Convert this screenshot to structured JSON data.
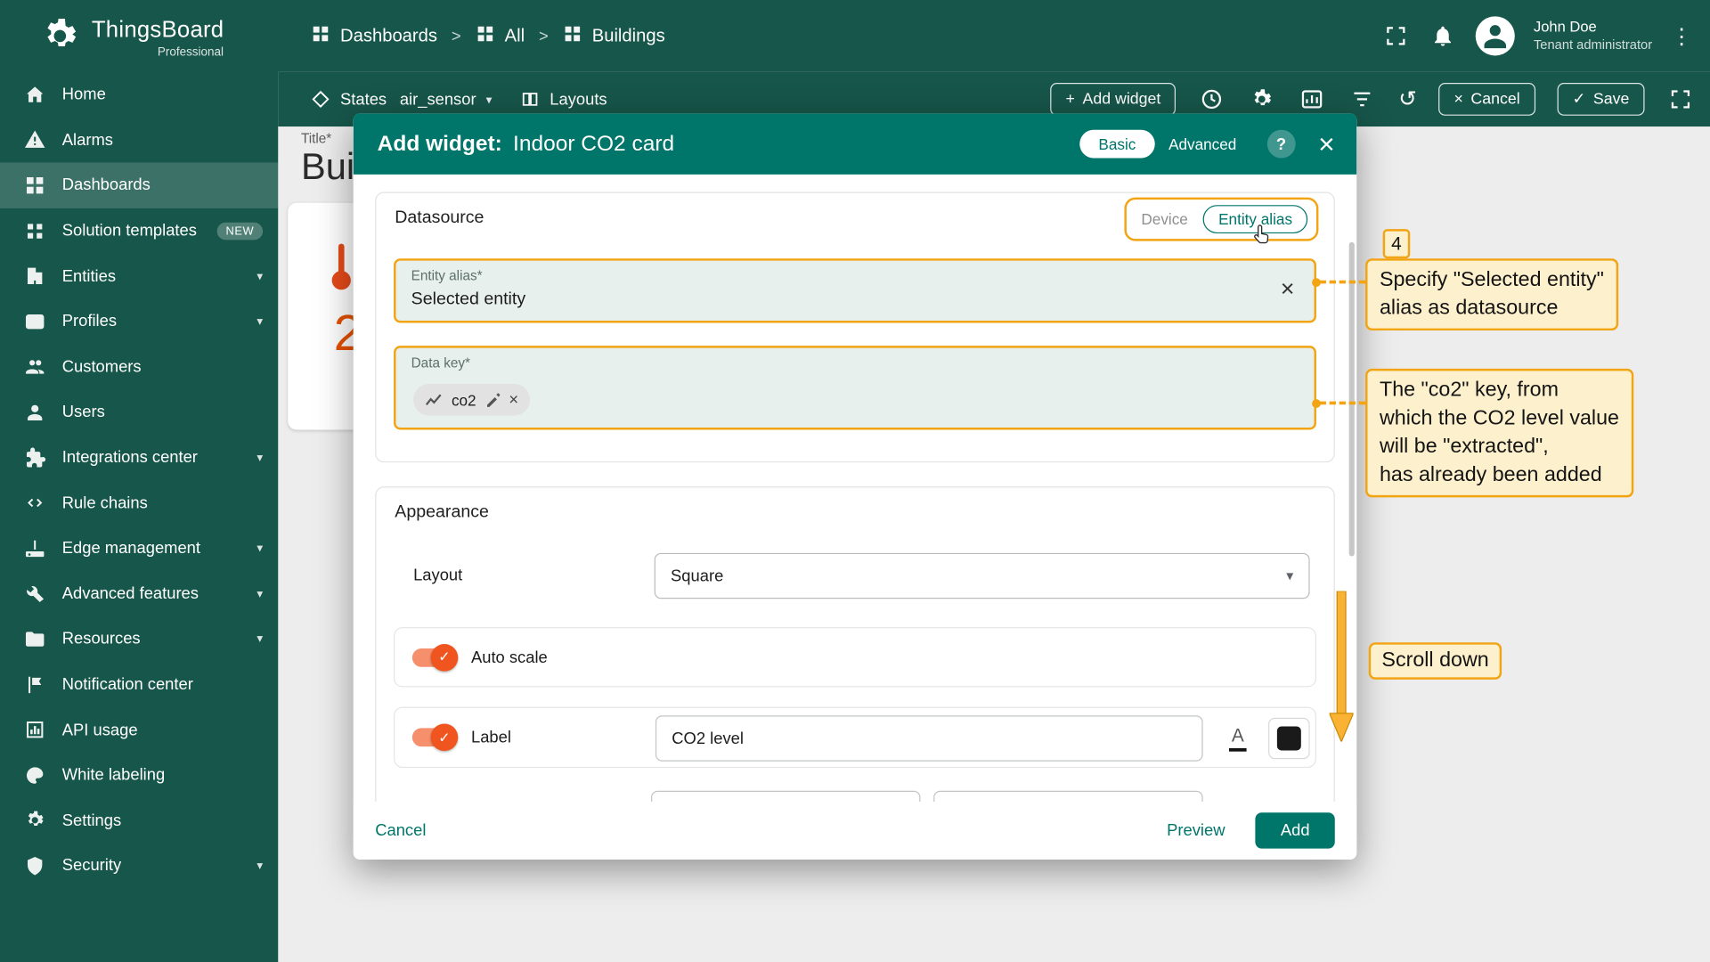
{
  "brand": {
    "name": "ThingsBoard",
    "subtitle": "Professional"
  },
  "header": {
    "separator": ">",
    "breadcrumb": [
      {
        "label": "Dashboards"
      },
      {
        "label": "All"
      },
      {
        "label": "Buildings"
      }
    ],
    "user": {
      "name": "John Doe",
      "role": "Tenant administrator"
    }
  },
  "toolbar": {
    "states_label": "States",
    "state_value": "air_sensor",
    "layouts_label": "Layouts",
    "add_widget_label": "Add widget",
    "cancel_label": "Cancel",
    "save_label": "Save"
  },
  "sidebar": {
    "items": [
      {
        "label": "Home"
      },
      {
        "label": "Alarms"
      },
      {
        "label": "Dashboards"
      },
      {
        "label": "Solution templates",
        "badge": "NEW"
      },
      {
        "label": "Entities"
      },
      {
        "label": "Profiles"
      },
      {
        "label": "Customers"
      },
      {
        "label": "Users"
      },
      {
        "label": "Integrations center"
      },
      {
        "label": "Rule chains"
      },
      {
        "label": "Edge management"
      },
      {
        "label": "Advanced features"
      },
      {
        "label": "Resources"
      },
      {
        "label": "Notification center"
      },
      {
        "label": "API usage"
      },
      {
        "label": "White labeling"
      },
      {
        "label": "Settings"
      },
      {
        "label": "Security"
      }
    ]
  },
  "background": {
    "title_label": "Title*",
    "title_value": "Bui",
    "widget_value": "2"
  },
  "modal": {
    "title_prefix": "Add widget:",
    "title": "Indoor CO2 card",
    "mode_basic": "Basic",
    "mode_advanced": "Advanced",
    "help_label": "?",
    "datasource": {
      "section_title": "Datasource",
      "type_device": "Device",
      "type_entity_alias": "Entity alias",
      "entity_alias_label": "Entity alias*",
      "entity_alias_value": "Selected entity",
      "data_key_label": "Data key*",
      "data_key_chip": "co2"
    },
    "appearance": {
      "section_title": "Appearance",
      "layout_label": "Layout",
      "layout_value": "Square",
      "auto_scale_label": "Auto scale",
      "label_label": "Label",
      "label_value": "CO2 level"
    },
    "footer": {
      "cancel": "Cancel",
      "preview": "Preview",
      "add": "Add"
    }
  },
  "annotations": {
    "step_number": "4",
    "callout_datasource": "Specify \"Selected entity\"\nalias as datasource",
    "callout_datakey": "The \"co2\" key, from\nwhich the CO2 level value\nwill be \"extracted\",\nhas already been added",
    "callout_scroll": "Scroll down"
  },
  "colors": {
    "sidebar_green": "#17564a",
    "accent_teal": "#00756a",
    "highlight_orange": "#f2a413",
    "callout_bg": "#fdf0cc",
    "toggle_on": "#f1551f",
    "widget_orange": "#e65100"
  }
}
